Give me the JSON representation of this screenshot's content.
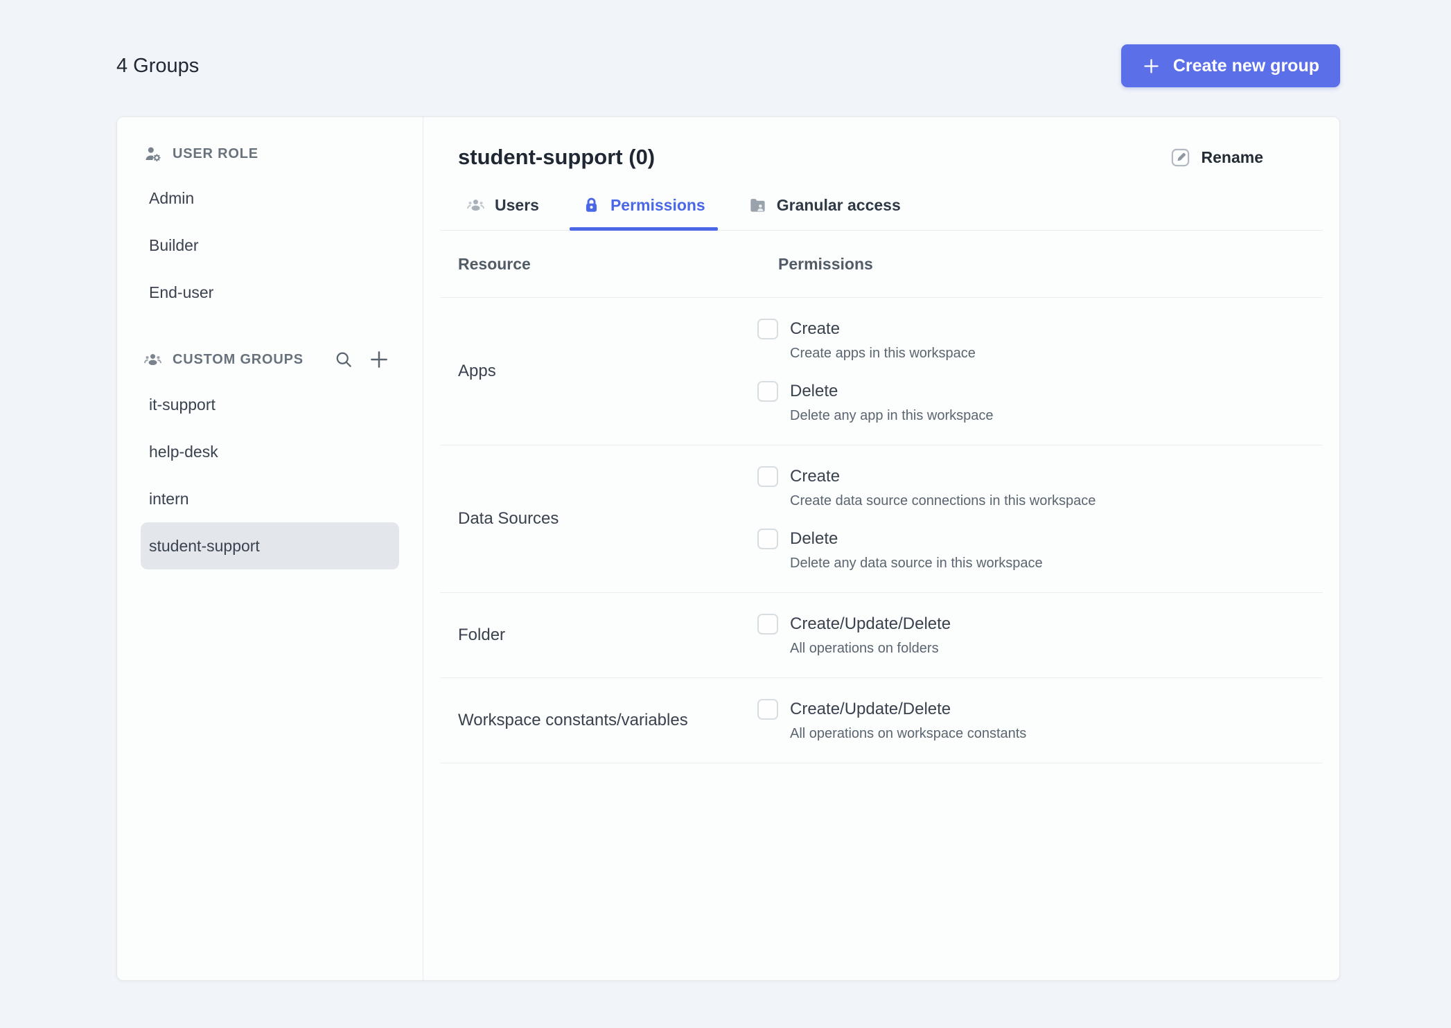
{
  "colors": {
    "accent_button_blue": "#5B6FE8",
    "tab_active_blue": "#4A67E6",
    "page_background": "#F1F4F9",
    "selected_item_background": "#E3E7EB"
  },
  "topbar": {
    "groups_count_label": "4 Groups",
    "create_group_label": "Create new group",
    "create_group_icon": "plus-icon"
  },
  "sidebar": {
    "user_role": {
      "title": "USER ROLE",
      "icon": "user-role-icon",
      "items": [
        {
          "label": "Admin",
          "selected": false
        },
        {
          "label": "Builder",
          "selected": false
        },
        {
          "label": "End-user",
          "selected": false
        }
      ]
    },
    "custom_groups": {
      "title": "CUSTOM GROUPS",
      "icon": "people-group-icon",
      "actions": [
        {
          "icon": "search-icon"
        },
        {
          "icon": "plus-icon"
        }
      ],
      "items": [
        {
          "label": "it-support",
          "selected": false
        },
        {
          "label": "help-desk",
          "selected": false
        },
        {
          "label": "intern",
          "selected": false
        },
        {
          "label": "student-support",
          "selected": true
        }
      ]
    }
  },
  "main": {
    "group_title": "student-support (0)",
    "rename_label": "Rename",
    "rename_icon": "edit-pencil-icon",
    "tabs": [
      {
        "label": "Users",
        "icon": "users-icon",
        "active": false
      },
      {
        "label": "Permissions",
        "icon": "lock-icon",
        "active": true
      },
      {
        "label": "Granular access",
        "icon": "folder-user-icon",
        "active": false
      }
    ],
    "permissions_table": {
      "columns": [
        "Resource",
        "Permissions"
      ],
      "rows": [
        {
          "resource": "Apps",
          "permissions": [
            {
              "label": "Create",
              "description": "Create apps in this workspace",
              "checked": false
            },
            {
              "label": "Delete",
              "description": "Delete any app in this workspace",
              "checked": false
            }
          ]
        },
        {
          "resource": "Data Sources",
          "permissions": [
            {
              "label": "Create",
              "description": "Create data source connections in this workspace",
              "checked": false
            },
            {
              "label": "Delete",
              "description": "Delete any data source in this workspace",
              "checked": false
            }
          ]
        },
        {
          "resource": "Folder",
          "permissions": [
            {
              "label": "Create/Update/Delete",
              "description": "All operations on folders",
              "checked": false
            }
          ]
        },
        {
          "resource": "Workspace constants/variables",
          "permissions": [
            {
              "label": "Create/Update/Delete",
              "description": "All operations on workspace constants",
              "checked": false
            }
          ]
        }
      ]
    }
  }
}
